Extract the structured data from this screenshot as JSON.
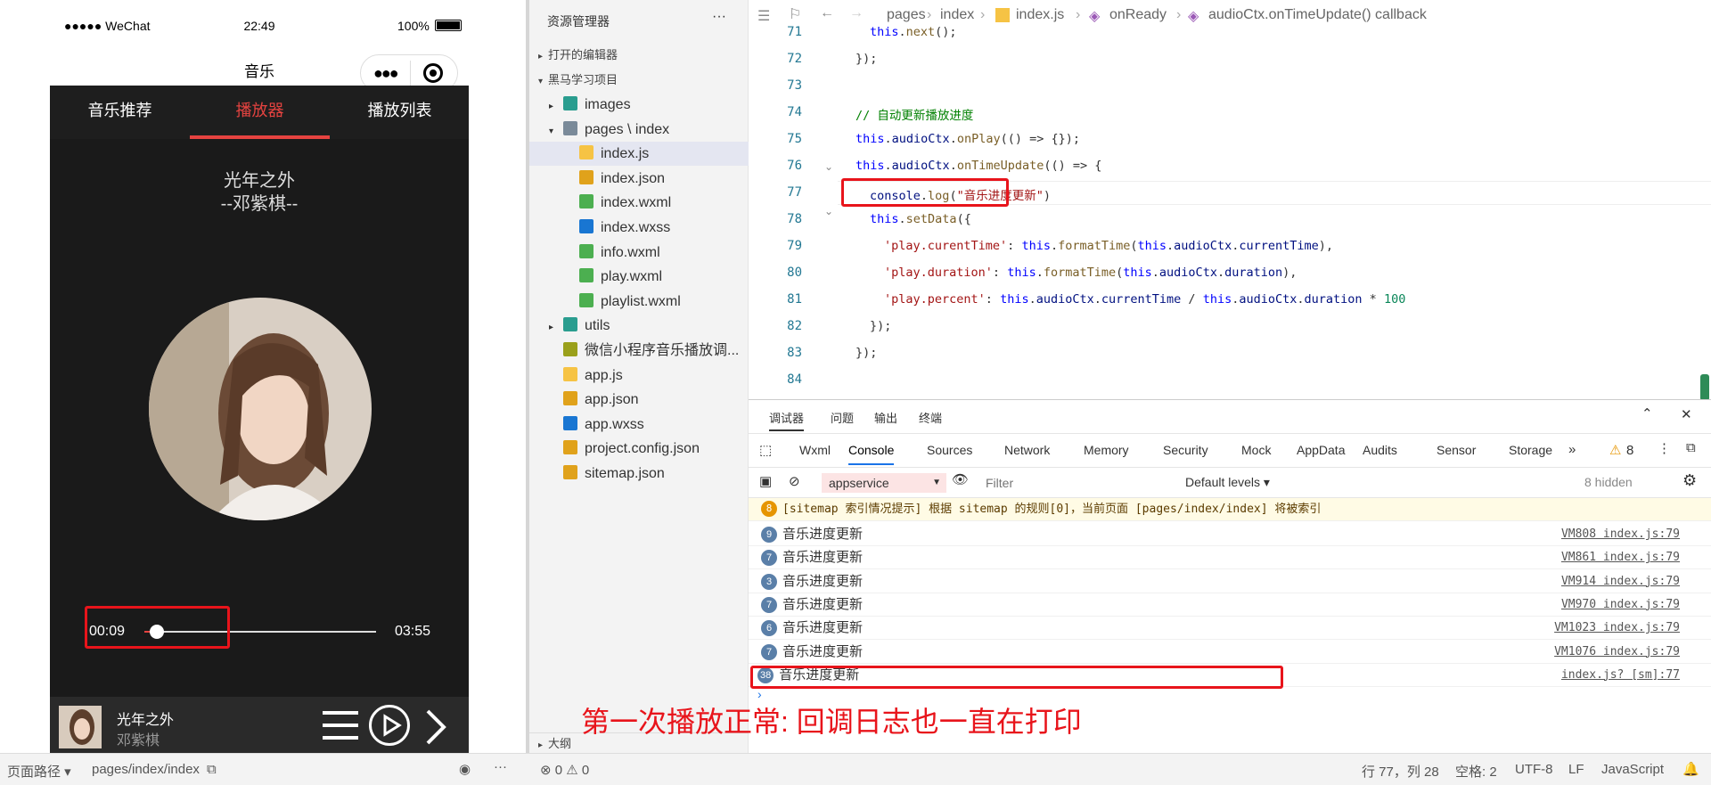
{
  "phone": {
    "signal": "●●●●● WeChat",
    "time": "22:49",
    "battery": "100%",
    "nav_title": "音乐",
    "tabs": [
      "音乐推荐",
      "播放器",
      "播放列表"
    ],
    "song_title": "光年之外",
    "artist_line": "--邓紫棋--",
    "current_time": "00:09",
    "duration": "03:55",
    "progress_percent": 4,
    "mini_title": "光年之外",
    "mini_artist": "邓紫棋"
  },
  "explorer": {
    "title": "资源管理器",
    "more": "···",
    "open_editors": "打开的编辑器",
    "project": "黑马学习项目",
    "items": [
      {
        "label": "images",
        "icon": "folder-icon",
        "indent": 1,
        "arrow": "▸"
      },
      {
        "label": "pages \\ index",
        "icon": "folder-open-icon",
        "indent": 1,
        "arrow": "▾"
      },
      {
        "label": "index.js",
        "icon": "js-file-icon",
        "indent": 2
      },
      {
        "label": "index.json",
        "icon": "json-file-icon",
        "indent": 2
      },
      {
        "label": "index.wxml",
        "icon": "wxml-file-icon",
        "indent": 2
      },
      {
        "label": "index.wxss",
        "icon": "wxss-file-icon",
        "indent": 2
      },
      {
        "label": "info.wxml",
        "icon": "wxml-file-icon",
        "indent": 2
      },
      {
        "label": "play.wxml",
        "icon": "wxml-file-icon",
        "indent": 2
      },
      {
        "label": "playlist.wxml",
        "icon": "wxml-file-icon",
        "indent": 2
      },
      {
        "label": "utils",
        "icon": "folder-icon",
        "indent": 1,
        "arrow": "▸"
      },
      {
        "label": "微信小程序音乐播放调...",
        "icon": "doc-file-icon",
        "indent": 1
      },
      {
        "label": "app.js",
        "icon": "js-file-icon",
        "indent": 1
      },
      {
        "label": "app.json",
        "icon": "json-file-icon",
        "indent": 1
      },
      {
        "label": "app.wxss",
        "icon": "wxss-file-icon",
        "indent": 1
      },
      {
        "label": "project.config.json",
        "icon": "json-file-icon",
        "indent": 1
      },
      {
        "label": "sitemap.json",
        "icon": "json-file-icon",
        "indent": 1
      }
    ],
    "outline": "大纲"
  },
  "editor": {
    "breadcrumb": [
      "pages",
      "index",
      "index.js",
      "onReady",
      "audioCtx.onTimeUpdate() callback"
    ],
    "line_numbers": [
      "71",
      "72",
      "73",
      "74",
      "75",
      "76",
      "77",
      "78",
      "79",
      "80",
      "81",
      "82",
      "83",
      "84"
    ]
  },
  "devtools": {
    "panel_tabs": [
      "调试器",
      "问题",
      "输出",
      "终端"
    ],
    "tool_tabs": [
      "Wxml",
      "Console",
      "Sources",
      "Network",
      "Memory",
      "Security",
      "Mock",
      "AppData",
      "Audits",
      "Sensor",
      "Storage"
    ],
    "warn_count": "8",
    "context": "appservice",
    "filter_placeholder": "Filter",
    "levels": "Default levels ▾",
    "hidden": "8 hidden",
    "warning_row": {
      "count": "8",
      "text": "[sitemap 索引情况提示] 根据 sitemap 的规则[0]，当前页面 [pages/index/index] 将被索引"
    },
    "logs": [
      {
        "count": "9",
        "text": "音乐进度更新",
        "link": "VM808 index.js:79"
      },
      {
        "count": "7",
        "text": "音乐进度更新",
        "link": "VM861 index.js:79"
      },
      {
        "count": "3",
        "text": "音乐进度更新",
        "link": "VM914 index.js:79"
      },
      {
        "count": "7",
        "text": "音乐进度更新",
        "link": "VM970 index.js:79"
      },
      {
        "count": "6",
        "text": "音乐进度更新",
        "link": "VM1023 index.js:79"
      },
      {
        "count": "7",
        "text": "音乐进度更新",
        "link": "VM1076 index.js:79"
      },
      {
        "count": "38",
        "text": "音乐进度更新",
        "link": "index.js? [sm]:77"
      }
    ],
    "prompt": "›"
  },
  "annotation": "第一次播放正常: 回调日志也一直在打印",
  "statusbar": {
    "page_path_label": "页面路径 ▾",
    "page_path": "pages/index/index",
    "errors": "⊗ 0 ⚠ 0",
    "cursor": "行 77，列 28",
    "spaces": "空格: 2",
    "encoding": "UTF-8",
    "eol": "LF",
    "language": "JavaScript"
  }
}
